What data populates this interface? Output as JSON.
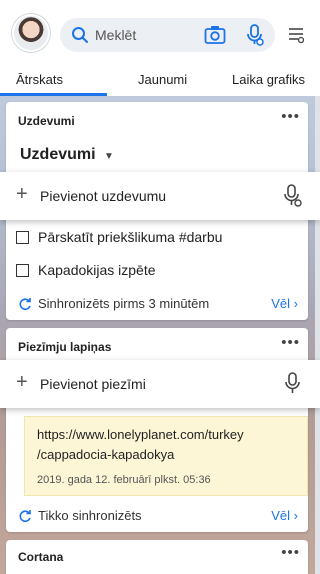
{
  "header": {
    "search_placeholder": "Meklēt"
  },
  "tabs": [
    {
      "label": "Ātrskats",
      "active": true
    },
    {
      "label": "Jaunumi",
      "active": false
    },
    {
      "label": "Laika grafiks",
      "active": false
    }
  ],
  "tasks_card": {
    "title": "Uzdevumi",
    "list_name": "Uzdevumi",
    "add_label": "Pievienot uzdevumu",
    "items": [
      {
        "label": "Pārskatīt priekšlikuma #darbu",
        "done": false
      },
      {
        "label": "Kapadokijas izpēte",
        "done": false
      }
    ],
    "sync_text": "Sinhronizēts pirms 3 minūtēm",
    "more_label": "Vēl ›"
  },
  "notes_card": {
    "title": "Piezīmju lapiņas",
    "add_label": "Pievienot piezīmi",
    "note": {
      "line1": "https://www.lonelyplanet.com/turkey",
      "line2": "/cappadocia-kapadokya",
      "date": "2019. gada 12. februārī plkst. 05:36",
      "color": "#fdf6d6"
    },
    "sync_text": "Tikko sinhronizēts",
    "more_label": "Vēl ›"
  },
  "cortana_card": {
    "title": "Cortana"
  },
  "colors": {
    "accent": "#1a73e8"
  }
}
